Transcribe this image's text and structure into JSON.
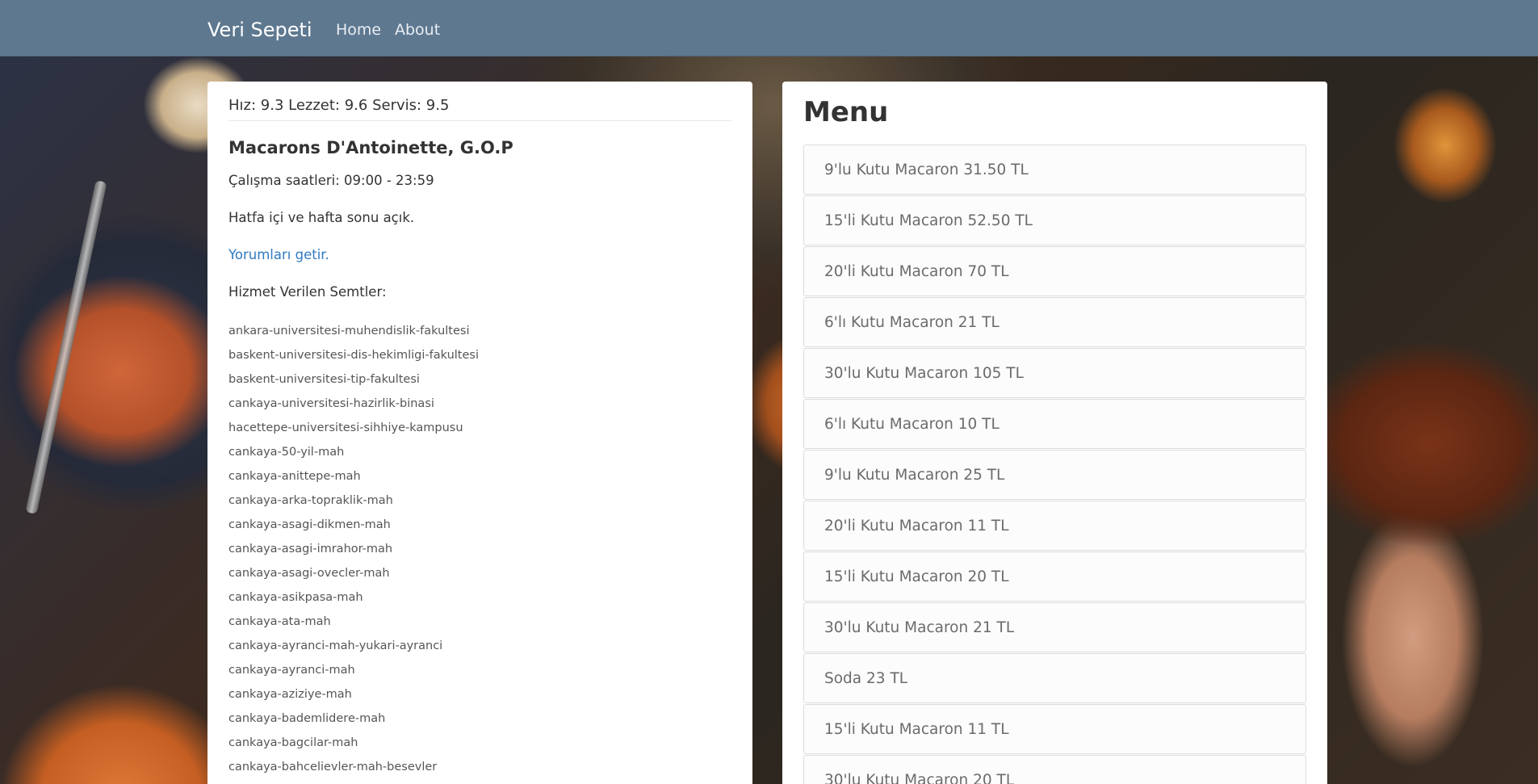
{
  "navbar": {
    "brand": "Veri Sepeti",
    "links": [
      "Home",
      "About"
    ]
  },
  "restaurant": {
    "scores": "Hız: 9.3 Lezzet: 9.6 Servis: 9.5",
    "name": "Macarons D'Antoinette, G.O.P",
    "hours": "Çalışma saatleri: 09:00 - 23:59",
    "open_days": "Hatfa içi ve hafta sonu açık.",
    "reviews_link": "Yorumları getir.",
    "areas_label": "Hizmet Verilen Semtler:",
    "areas": [
      "ankara-universitesi-muhendislik-fakultesi",
      "baskent-universitesi-dis-hekimligi-fakultesi",
      "baskent-universitesi-tip-fakultesi",
      "cankaya-universitesi-hazirlik-binasi",
      "hacettepe-universitesi-sihhiye-kampusu",
      "cankaya-50-yil-mah",
      "cankaya-anittepe-mah",
      "cankaya-arka-topraklik-mah",
      "cankaya-asagi-dikmen-mah",
      "cankaya-asagi-imrahor-mah",
      "cankaya-asagi-ovecler-mah",
      "cankaya-asikpasa-mah",
      "cankaya-ata-mah",
      "cankaya-ayranci-mah-yukari-ayranci",
      "cankaya-ayranci-mah",
      "cankaya-aziziye-mah",
      "cankaya-bademlidere-mah",
      "cankaya-bagcilar-mah",
      "cankaya-bahcelievler-mah-besevler"
    ]
  },
  "menu": {
    "title": "Menu",
    "items": [
      "9'lu Kutu Macaron 31.50 TL",
      "15'li Kutu Macaron 52.50 TL",
      "20'li Kutu Macaron 70 TL",
      "6'lı Kutu Macaron 21 TL",
      "30'lu Kutu Macaron 105 TL",
      "6'lı Kutu Macaron 10 TL",
      "9'lu Kutu Macaron 25 TL",
      "20'li Kutu Macaron 11 TL",
      "15'li Kutu Macaron 20 TL",
      "30'lu Kutu Macaron 21 TL",
      "Soda 23 TL",
      "15'li Kutu Macaron 11 TL",
      "30'lu Kutu Macaron 20 TL"
    ]
  },
  "colors": {
    "navbar": "#5e7890",
    "link": "#2f7ac0"
  }
}
